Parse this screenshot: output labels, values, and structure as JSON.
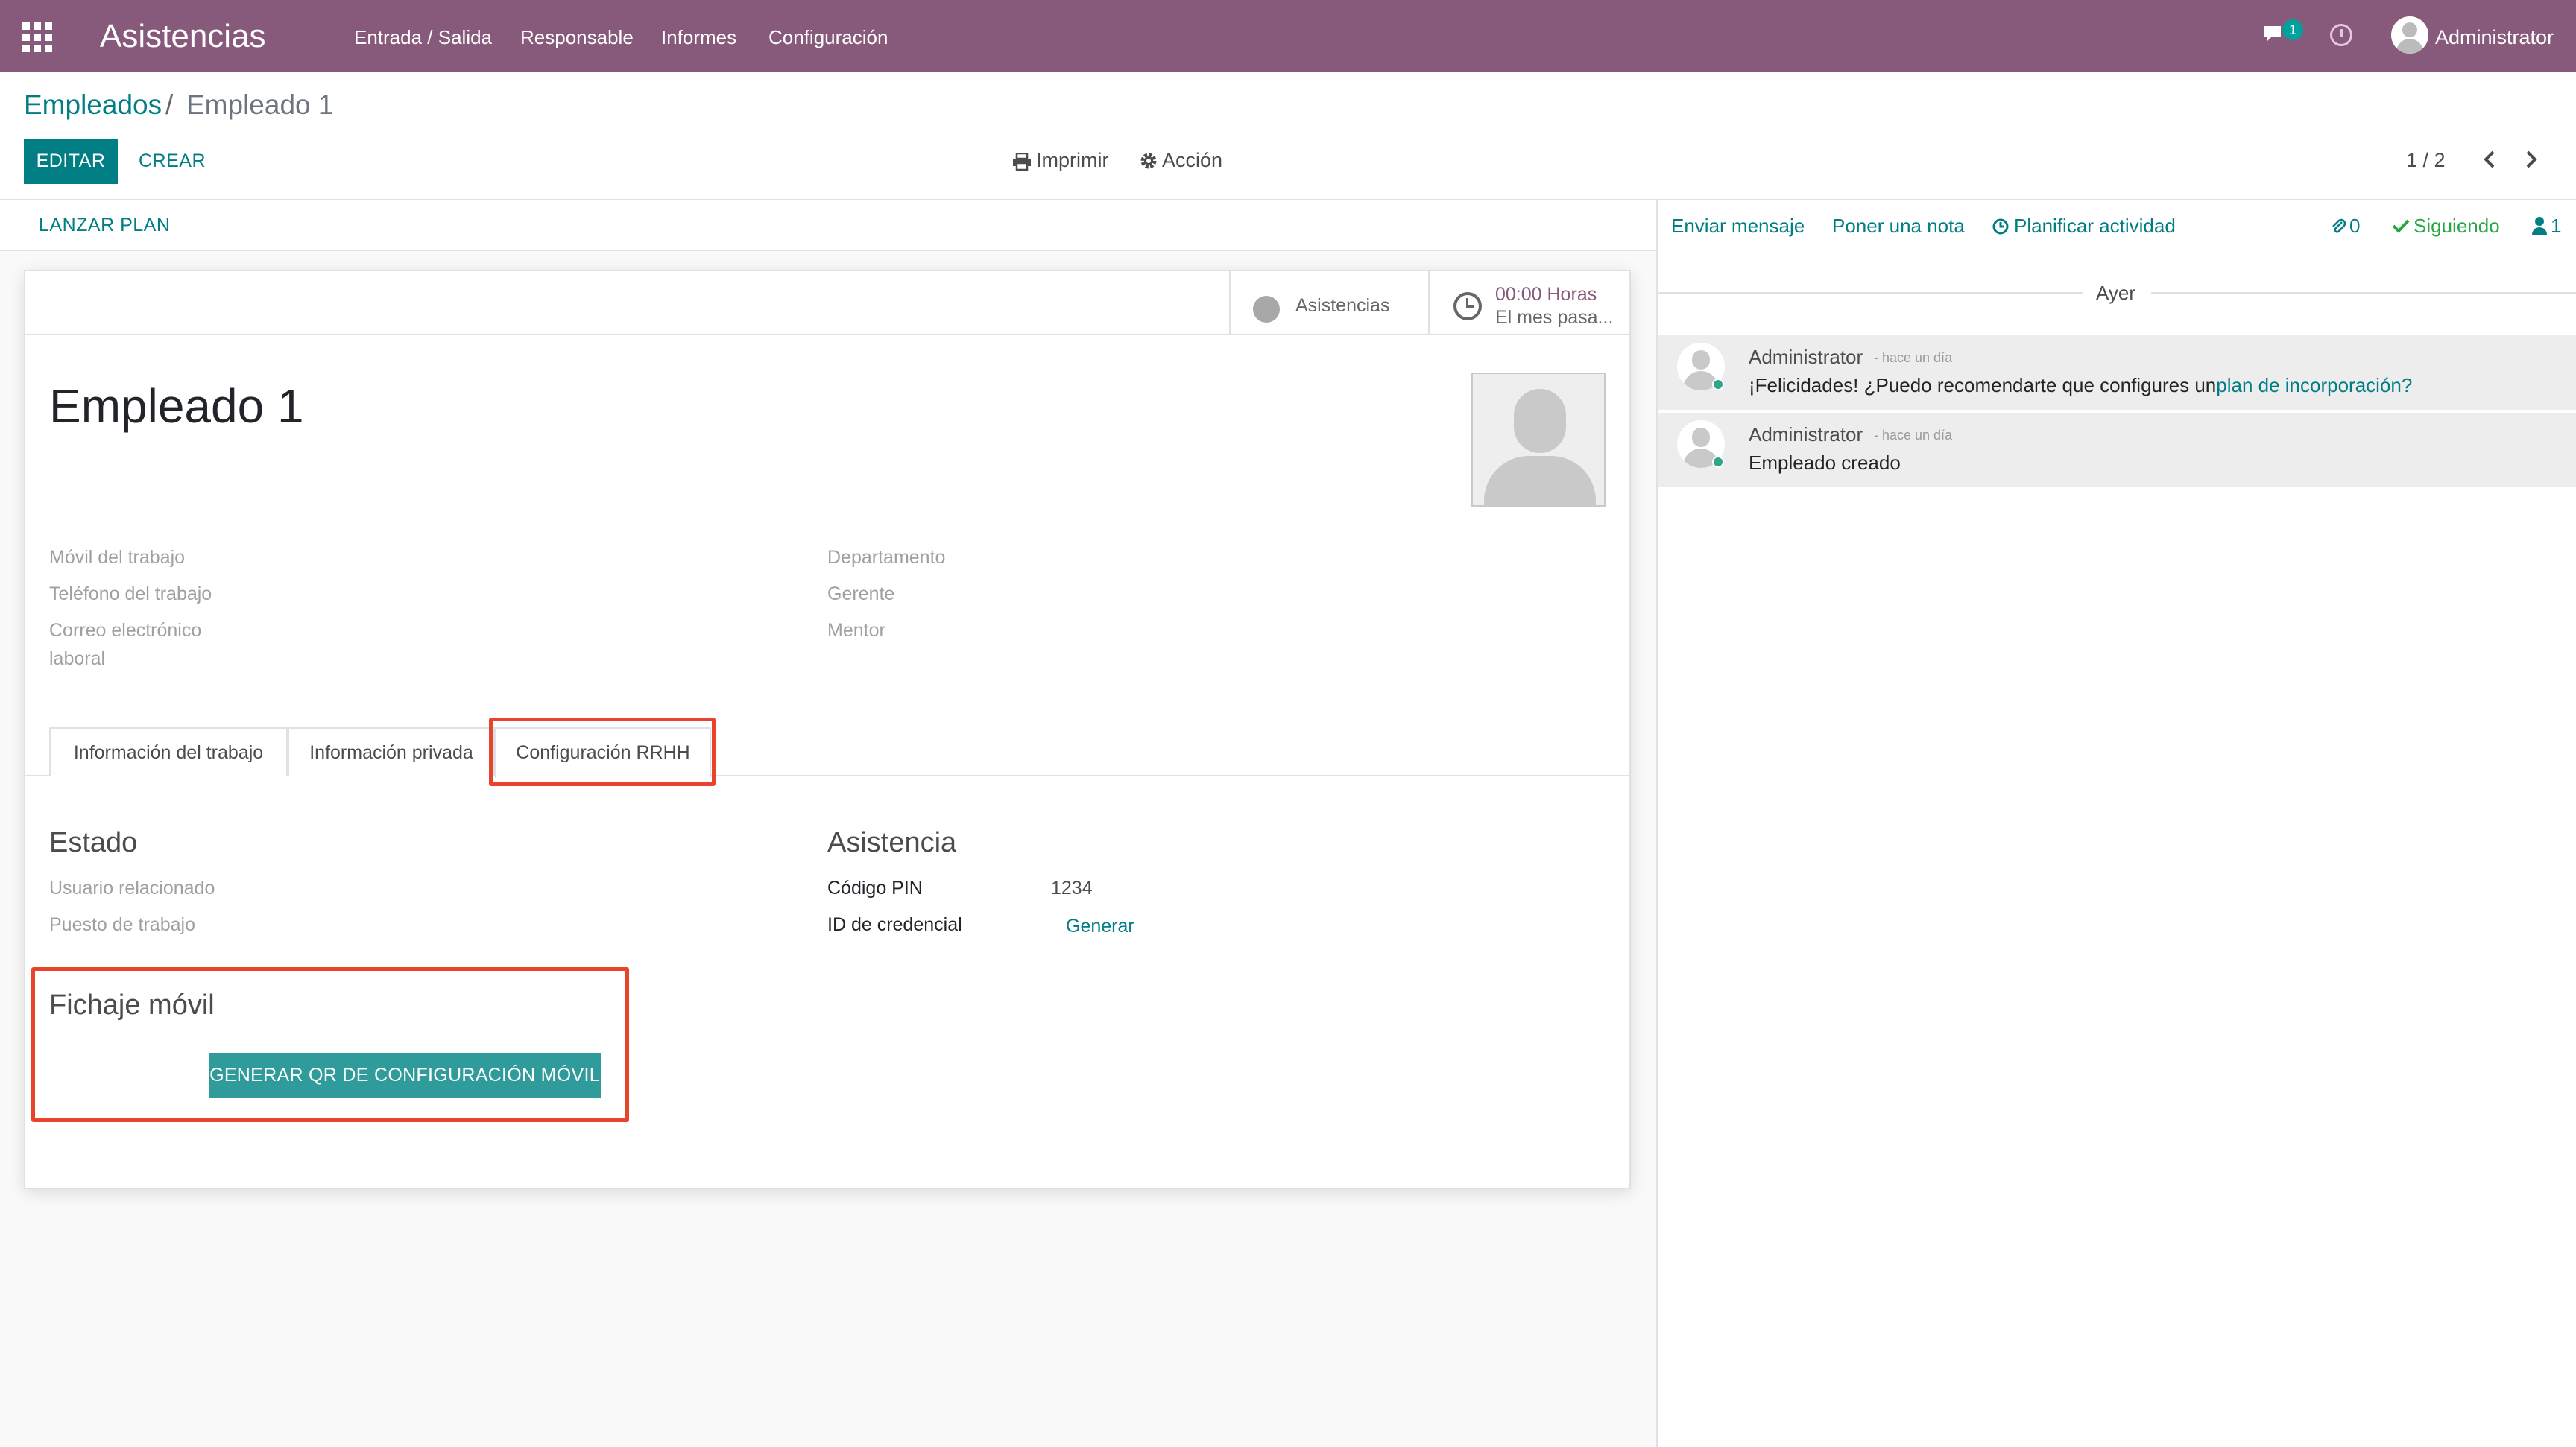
{
  "navbar": {
    "app_title": "Asistencias",
    "menu": [
      "Entrada / Salida",
      "Responsable",
      "Informes",
      "Configuración"
    ],
    "messages_count": "1",
    "user": "Administrator"
  },
  "breadcrumb": {
    "parent": "Empleados",
    "separator": "/",
    "current": "Empleado 1"
  },
  "buttons": {
    "edit": "EDITAR",
    "create": "CREAR",
    "print": "Imprimir",
    "action": "Acción"
  },
  "pager": {
    "value": "1 / 2"
  },
  "statusbar": {
    "launch_plan": "LANZAR PLAN"
  },
  "smart_buttons": {
    "attendance_label": "Asistencias",
    "hours_value": "00:00 Horas",
    "hours_sub": "El mes pasa..."
  },
  "employee": {
    "name": "Empleado 1"
  },
  "fields_left": [
    "Móvil del trabajo",
    "Teléfono del trabajo",
    "Correo electrónico",
    "laboral"
  ],
  "fields_right": [
    "Departamento",
    "Gerente",
    "Mentor"
  ],
  "tabs": [
    "Información del trabajo",
    "Información privada",
    "Configuración RRHH"
  ],
  "estado": {
    "title": "Estado",
    "fields": [
      "Usuario relacionado",
      "Puesto de trabajo"
    ]
  },
  "asistencia": {
    "title": "Asistencia",
    "pin_label": "Código PIN",
    "pin_value": "1234",
    "badge_label": "ID de credencial",
    "badge_action": "Generar"
  },
  "fichaje": {
    "title": "Fichaje móvil",
    "button": "GENERAR QR DE CONFIGURACIÓN MÓVIL"
  },
  "chatter": {
    "send_message": "Enviar mensaje",
    "log_note": "Poner una nota",
    "schedule": "Planificar actividad",
    "attachments": "0",
    "following": "Siguiendo",
    "followers": "1",
    "date_separator": "Ayer",
    "messages": [
      {
        "author": "Administrator",
        "date": "- hace un día",
        "body_prefix": "¡Felicidades! ¿Puedo recomendarte que configures un",
        "body_link": "plan de incorporación?"
      },
      {
        "author": "Administrator",
        "date": "- hace un día",
        "body_prefix": "Empleado creado",
        "body_link": ""
      }
    ]
  },
  "colors": {
    "brand": "#875a7b",
    "primary": "#017e84",
    "highlight": "#e8442b"
  }
}
